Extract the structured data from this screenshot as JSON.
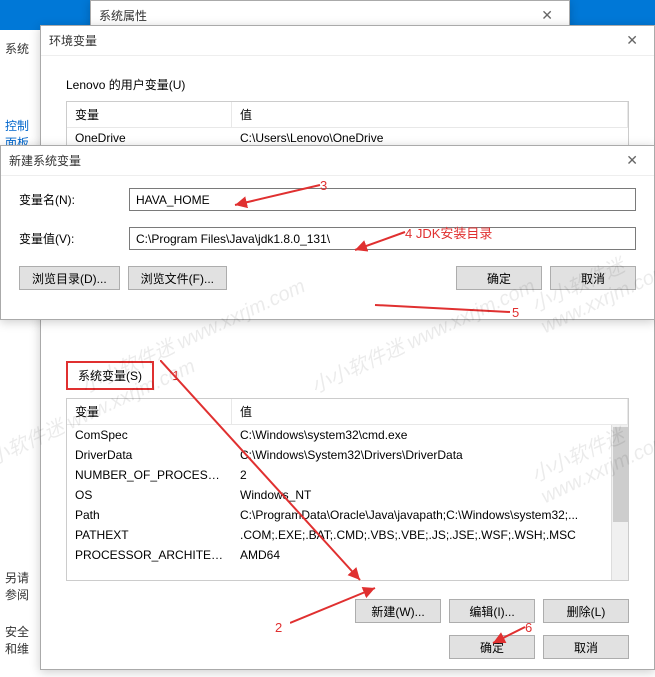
{
  "bg": {
    "sys_title": "系统属性",
    "sidebar_text": "系统",
    "sidebar_link": "控制面板",
    "sidebar_bottom1": "另请参阅",
    "sidebar_bottom2": "安全和维"
  },
  "env": {
    "title": "环境变量",
    "user_section": "Lenovo 的用户变量(U)",
    "headers": {
      "var": "变量",
      "val": "值"
    },
    "user_rows": [
      {
        "var": "OneDrive",
        "val": "C:\\Users\\Lenovo\\OneDrive"
      }
    ],
    "sys_section": "系统变量(S)",
    "sys_rows": [
      {
        "var": "ComSpec",
        "val": "C:\\Windows\\system32\\cmd.exe"
      },
      {
        "var": "DriverData",
        "val": "C:\\Windows\\System32\\Drivers\\DriverData"
      },
      {
        "var": "NUMBER_OF_PROCESSORS",
        "val": "2"
      },
      {
        "var": "OS",
        "val": "Windows_NT"
      },
      {
        "var": "Path",
        "val": "C:\\ProgramData\\Oracle\\Java\\javapath;C:\\Windows\\system32;..."
      },
      {
        "var": "PATHEXT",
        "val": ".COM;.EXE;.BAT;.CMD;.VBS;.VBE;.JS;.JSE;.WSF;.WSH;.MSC"
      },
      {
        "var": "PROCESSOR_ARCHITECT...",
        "val": "AMD64"
      }
    ],
    "buttons": {
      "new": "新建(W)...",
      "edit": "编辑(I)...",
      "delete": "删除(L)",
      "ok": "确定",
      "cancel": "取消"
    }
  },
  "newdlg": {
    "title": "新建系统变量",
    "name_label": "变量名(N):",
    "name_value": "HAVA_HOME",
    "value_label": "变量值(V):",
    "value_value": "C:\\Program Files\\Java\\jdk1.8.0_131\\",
    "browse_dir": "浏览目录(D)...",
    "browse_file": "浏览文件(F)...",
    "ok": "确定",
    "cancel": "取消"
  },
  "annotations": {
    "a1": "1",
    "a2": "2",
    "a3": "3",
    "a4": "4 JDK安装目录",
    "a5": "5",
    "a6": "6"
  },
  "watermark": "小小软件迷  www.xxrjm.com"
}
